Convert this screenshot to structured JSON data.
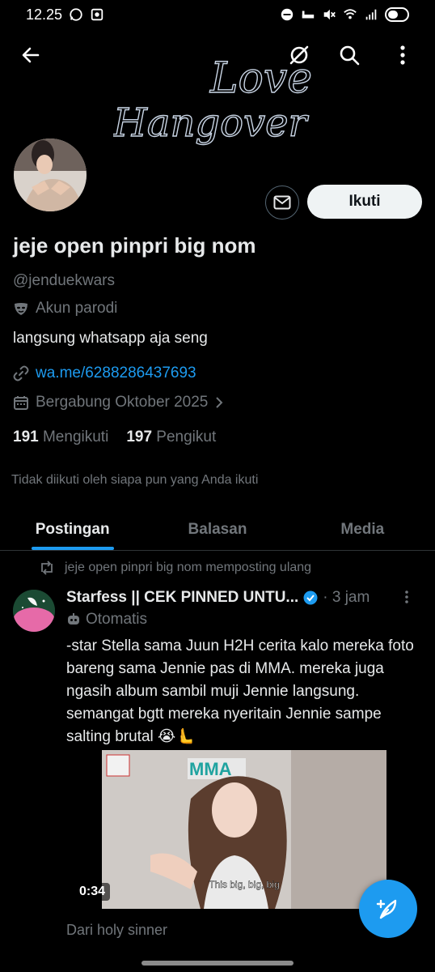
{
  "status_bar": {
    "time": "12.25"
  },
  "banner": {
    "logo_line1": "Love",
    "logo_line2": "Hangover"
  },
  "profile": {
    "name": "jeje open pinpri big nom",
    "handle": "@jenduekwars",
    "parody_label": "Akun parodi",
    "bio": "langsung whatsapp aja seng",
    "link": "wa.me/6288286437693",
    "joined": "Bergabung Oktober 2025",
    "following_count": "191",
    "following_label": "Mengikuti",
    "followers_count": "197",
    "followers_label": "Pengikut",
    "not_followed_text": "Tidak diikuti oleh siapa pun yang Anda ikuti"
  },
  "actions": {
    "follow_label": "Ikuti"
  },
  "tabs": [
    {
      "label": "Postingan",
      "active": true
    },
    {
      "label": "Balasan",
      "active": false
    },
    {
      "label": "Media",
      "active": false
    }
  ],
  "post": {
    "repost_line": "jeje open pinpri big nom memposting ulang",
    "author": "Starfess || CEK PINNED UNTU...",
    "time": "· 3 jam",
    "automated_label": "Otomatis",
    "text": "-star Stella sama Juun H2H cerita kalo mereka foto bareng sama Jennie pas di MMA. mereka juga ngasih album sambil muji Jennie langsung. semangat bgtt mereka nyeritain Jennie sampe salting brutal 😭🫷",
    "video_duration": "0:34",
    "video_caption_en": "This big, big, big",
    "video_sign": "MMA",
    "from_line": "Dari holy sinner"
  },
  "colors": {
    "accent": "#1d9bf0",
    "background": "#000000",
    "muted": "#71767b",
    "text": "#e7e9ea"
  }
}
